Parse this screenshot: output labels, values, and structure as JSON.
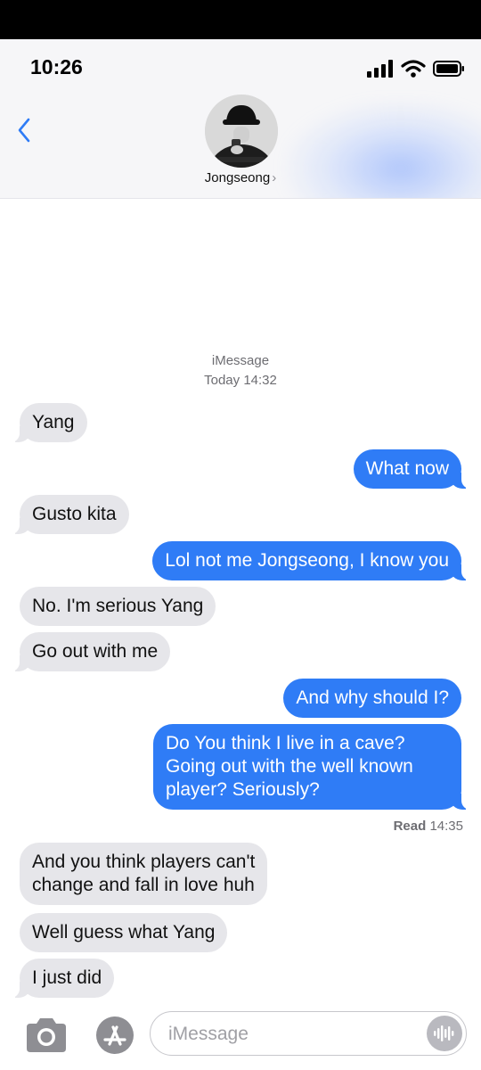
{
  "status_bar": {
    "time": "10:26"
  },
  "header": {
    "contact_name": "Jongseong",
    "chevron": "›"
  },
  "conversation": {
    "service": "iMessage",
    "date": "Today 14:32",
    "messages": [
      {
        "from": "them",
        "text": "Yang"
      },
      {
        "from": "me",
        "text": "What now"
      },
      {
        "from": "them",
        "text": "Gusto kita"
      },
      {
        "from": "me",
        "text": "Lol not me Jongseong, I know you"
      },
      {
        "from": "them",
        "text": "No. I'm serious Yang"
      },
      {
        "from": "them",
        "text": "Go out with me"
      },
      {
        "from": "me",
        "text": "And why should I?"
      },
      {
        "from": "me",
        "lines": [
          "Do You think I live in a cave?",
          "Going out with the well known",
          "player? Seriously?"
        ]
      },
      {
        "from": "them",
        "lines": [
          "And you think players can't",
          "change and fall in love huh"
        ]
      },
      {
        "from": "them",
        "text": "Well guess what Yang"
      },
      {
        "from": "them",
        "text": "I just did"
      }
    ],
    "receipt": {
      "label": "Read",
      "time": "14:35"
    }
  },
  "composer": {
    "placeholder": "iMessage"
  },
  "colors": {
    "outgoing": "#2f7cf6",
    "incoming": "#e6e6ea",
    "accent": "#2f7cf6"
  },
  "icons": [
    "back-chevron-icon",
    "camera-icon",
    "app-store-icon",
    "audio-waveform-icon",
    "signal-icon",
    "wifi-icon",
    "battery-icon"
  ]
}
